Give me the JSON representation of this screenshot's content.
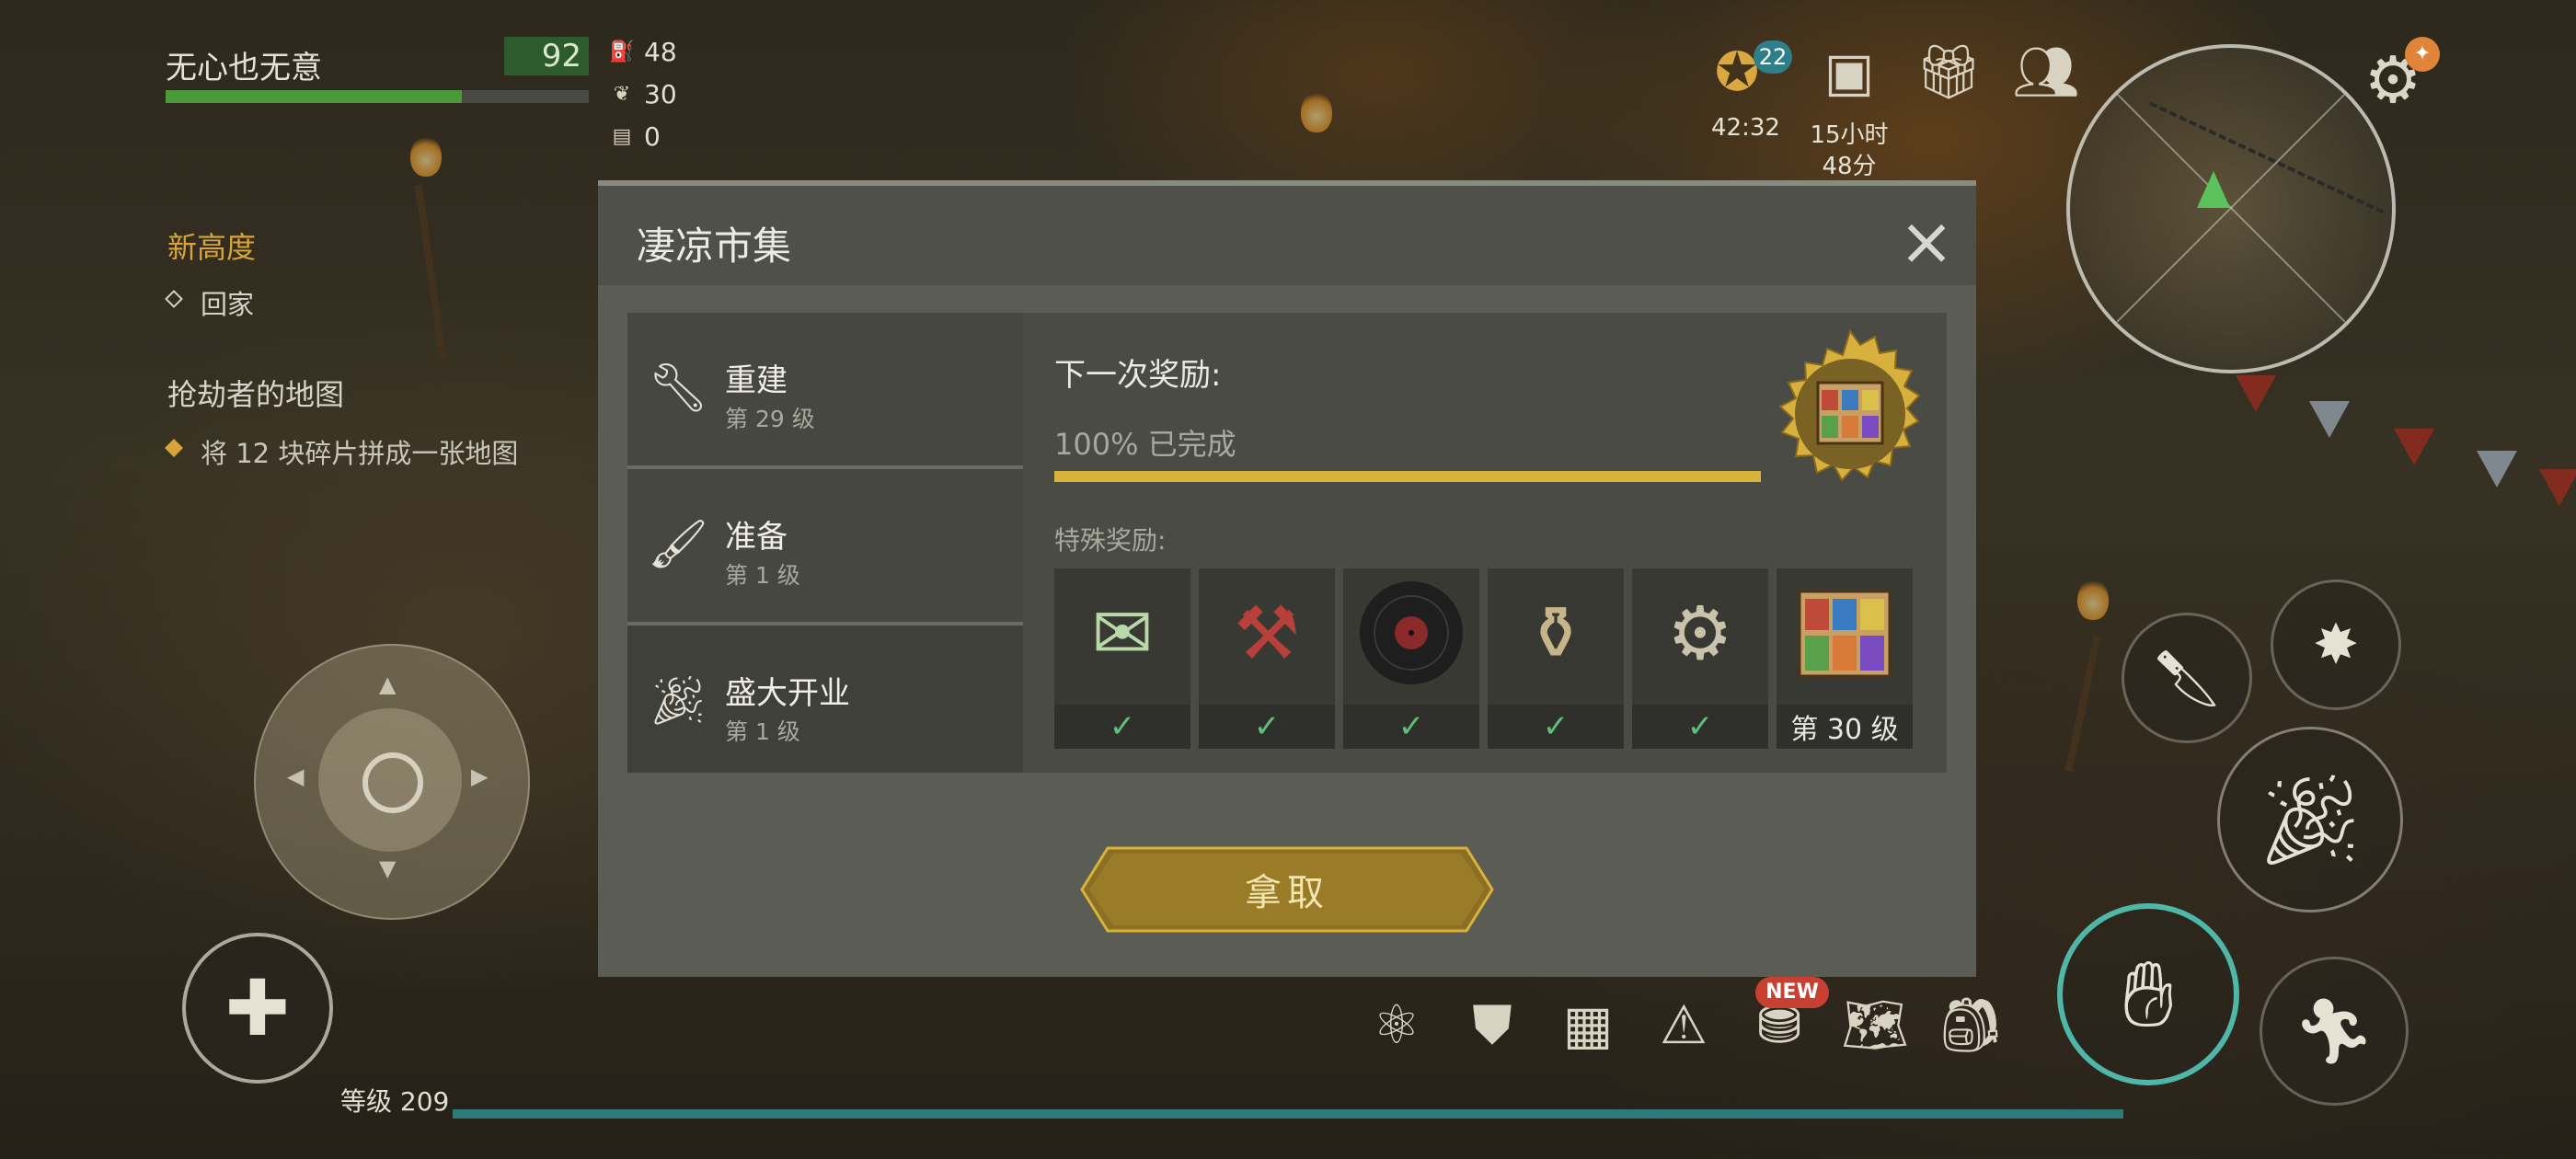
{
  "player": {
    "name": "无心也无意",
    "hp": "92",
    "hp_fraction": 0.7
  },
  "resources": [
    {
      "icon": "fuel-icon",
      "value": "48"
    },
    {
      "icon": "seed-icon",
      "value": "30"
    },
    {
      "icon": "document-icon",
      "value": "0"
    }
  ],
  "quests": [
    {
      "title": "新高度",
      "task": "回家"
    },
    {
      "title": "抢劫者的地图",
      "task": "将 12 块碎片拼成一张地图"
    }
  ],
  "top_bar": {
    "discount_badge": "22",
    "discount_timer": "42:32",
    "pass_timer_line1": "15小时",
    "pass_timer_line2": "48分"
  },
  "dialog": {
    "title": "凄凉市集",
    "close_glyph": "×",
    "tabs": [
      {
        "name": "重建",
        "level": "第 29 级",
        "icon": "wrench-icon"
      },
      {
        "name": "准备",
        "level": "第 1 级",
        "icon": "brush-icon"
      },
      {
        "name": "盛大开业",
        "level": "第 1 级",
        "icon": "party-popper-icon"
      }
    ],
    "next_reward_label": "下一次奖励:",
    "progress_text": "100% 已完成",
    "progress_fraction": 1.0,
    "special_rewards_label": "特殊奖励:",
    "special_rewards": [
      {
        "item": "seed-packet-icon",
        "status": "✓"
      },
      {
        "item": "chainsaw-icon",
        "status": "✓"
      },
      {
        "item": "vinyl-record-icon",
        "status": "✓"
      },
      {
        "item": "thermos-icon",
        "status": "✓"
      },
      {
        "item": "engine-part-icon",
        "status": "✓"
      },
      {
        "item": "market-stall-icon",
        "status": "第 30 级"
      }
    ],
    "claim_label": "拿取"
  },
  "toolbar": {
    "new_badge": "NEW"
  },
  "level_label": "等级 209",
  "colors": {
    "gold": "#d9b23a",
    "check_green": "#5ec07a",
    "teal": "#4fb7a8",
    "quest_orange": "#d7a538"
  }
}
